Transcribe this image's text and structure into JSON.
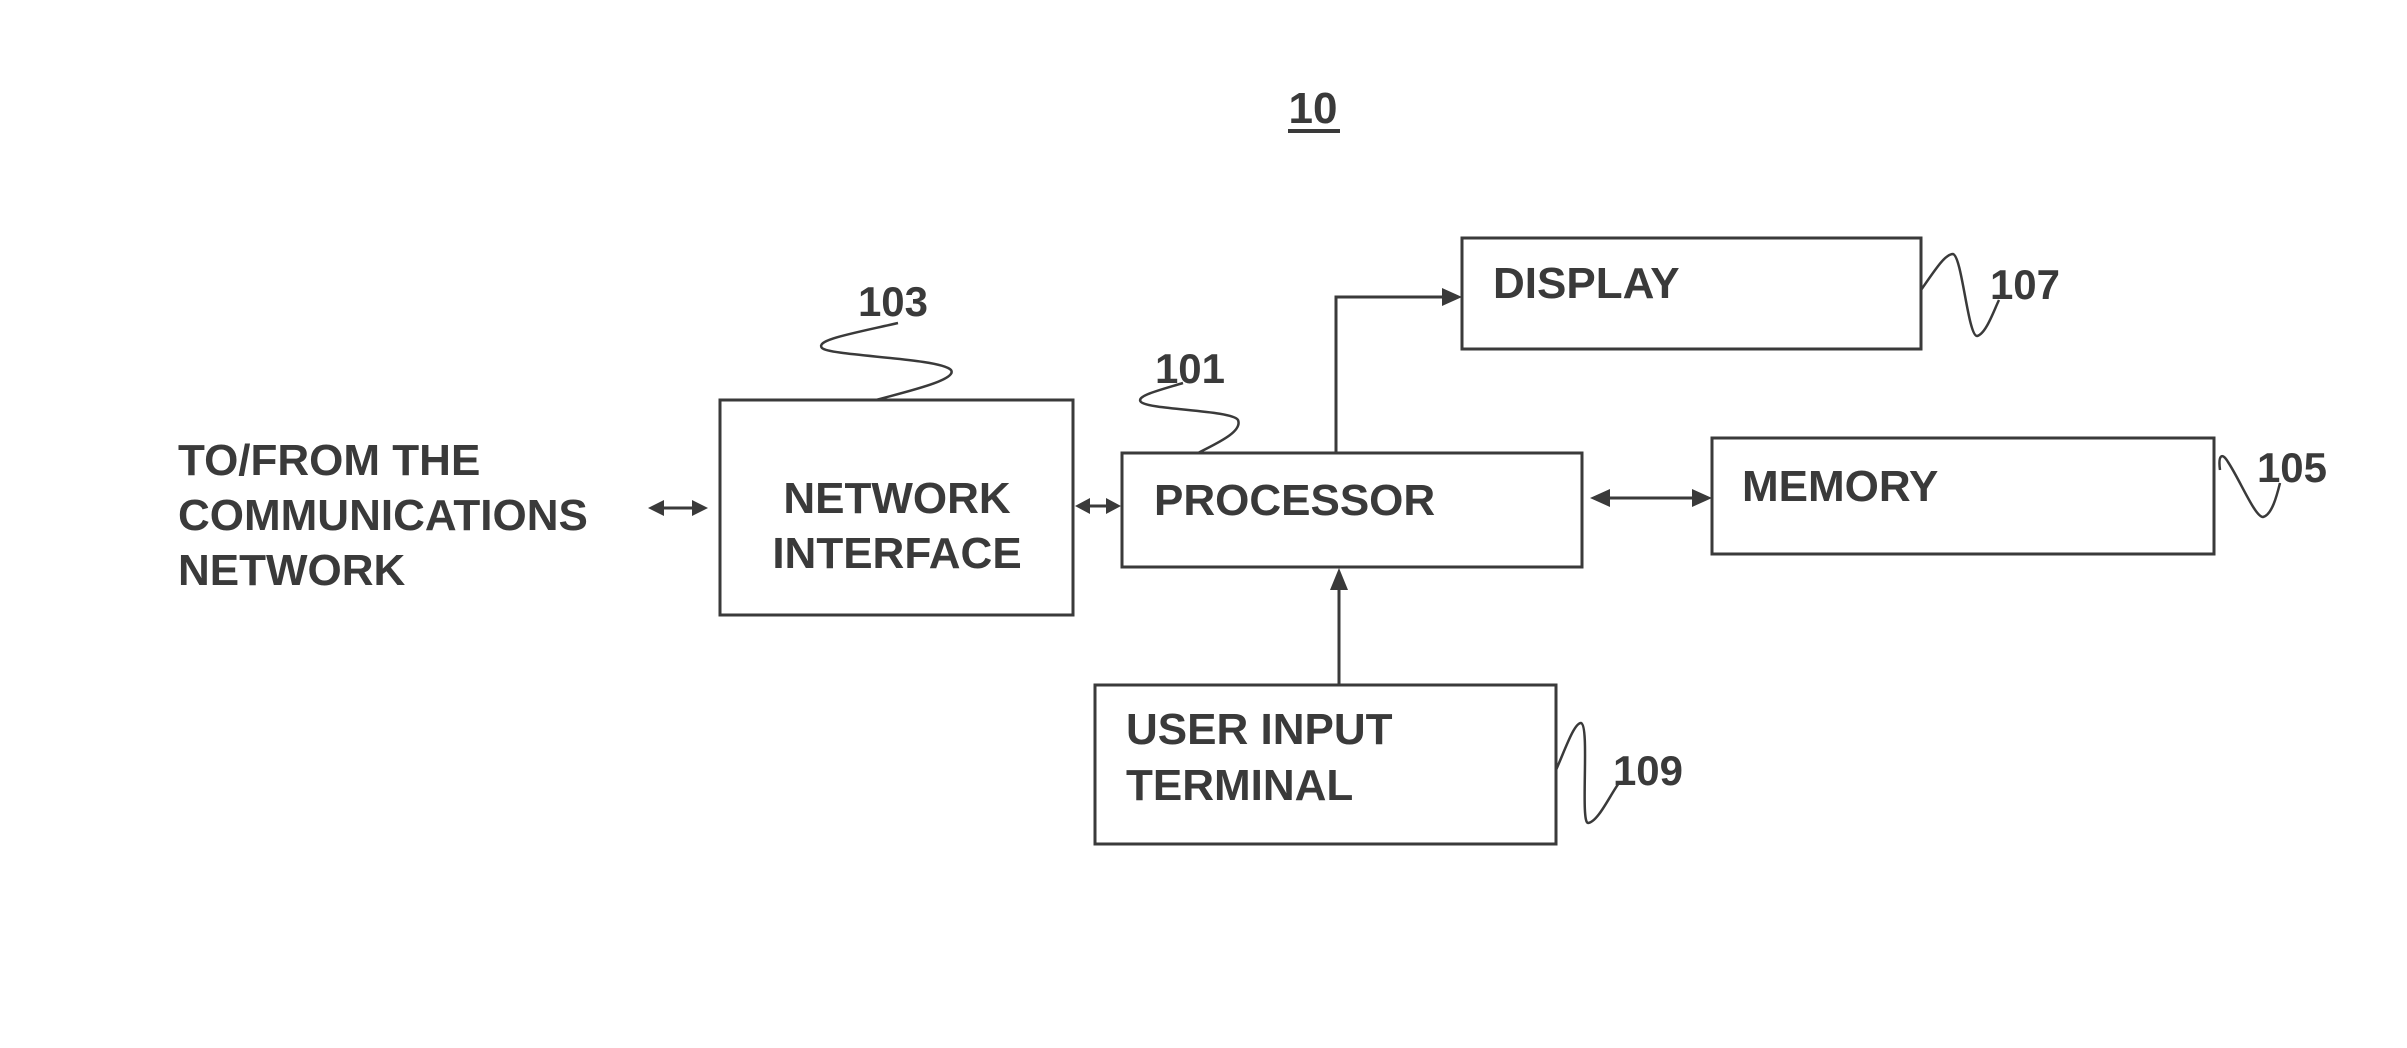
{
  "figure": {
    "number": "10"
  },
  "external": {
    "lines": [
      "TO/FROM THE",
      "COMMUNICATIONS",
      "NETWORK"
    ]
  },
  "blocks": {
    "network_interface": {
      "lines": [
        "NETWORK",
        "INTERFACE"
      ],
      "ref": "103"
    },
    "processor": {
      "lines": [
        "PROCESSOR"
      ],
      "ref": "101"
    },
    "display": {
      "lines": [
        "DISPLAY"
      ],
      "ref": "107"
    },
    "memory": {
      "lines": [
        "MEMORY"
      ],
      "ref": "105"
    },
    "user_input_terminal": {
      "lines": [
        "USER INPUT",
        "TERMINAL"
      ],
      "ref": "109"
    }
  },
  "connections": [
    {
      "from": "external",
      "to": "network_interface",
      "direction": "bidirectional"
    },
    {
      "from": "network_interface",
      "to": "processor",
      "direction": "bidirectional"
    },
    {
      "from": "processor",
      "to": "display",
      "direction": "forward"
    },
    {
      "from": "processor",
      "to": "memory",
      "direction": "bidirectional"
    },
    {
      "from": "user_input_terminal",
      "to": "processor",
      "direction": "forward"
    }
  ]
}
